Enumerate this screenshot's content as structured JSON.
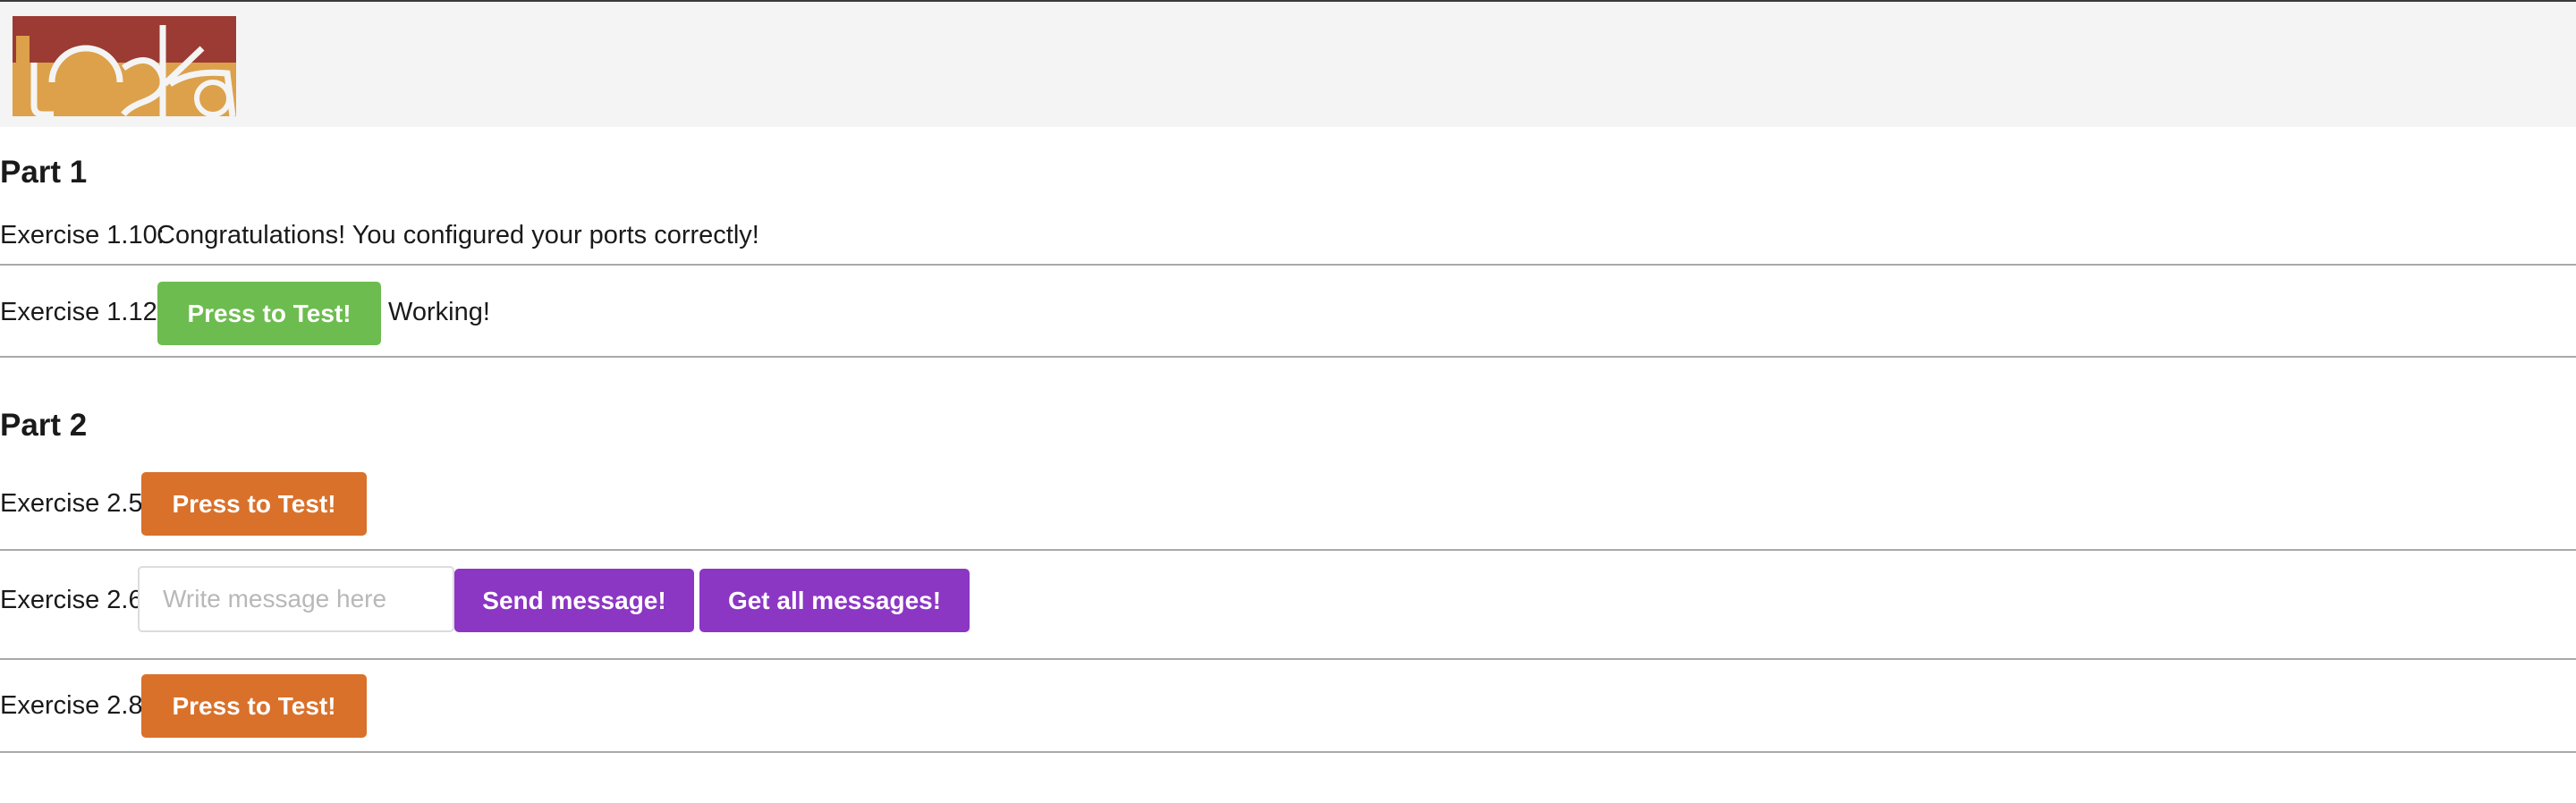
{
  "header": {
    "logo": {
      "icon": "toska-logo",
      "text": "toska",
      "colors": {
        "dark": "#9b3b33",
        "light": "#dca14a"
      }
    }
  },
  "part1": {
    "title": "Part 1",
    "exercise_1_10": {
      "label": "Exercise 1.10:",
      "status": "Congratulations! You configured your ports correctly!"
    },
    "exercise_1_12": {
      "label": "Exercise 1.12:",
      "button": "Press to Test!",
      "result": "Working!"
    }
  },
  "part2": {
    "title": "Part 2",
    "exercise_2_5": {
      "label": "Exercise 2.5:",
      "button": "Press to Test!"
    },
    "exercise_2_6": {
      "label": "Exercise 2.6:",
      "input_placeholder": "Write message here",
      "input_value": "",
      "send_button": "Send message!",
      "get_button": "Get all messages!"
    },
    "exercise_2_8": {
      "label": "Exercise 2.8:",
      "button": "Press to Test!"
    }
  },
  "colors": {
    "green": "#6dbc4f",
    "orange": "#d9712b",
    "purple": "#8c36c4",
    "header_bg": "#f4f4f4"
  }
}
